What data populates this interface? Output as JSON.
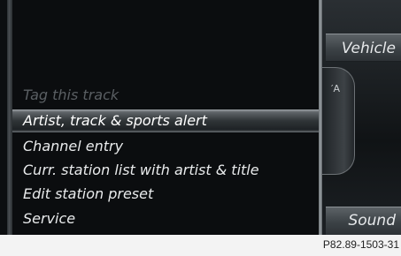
{
  "right_panel": {
    "vehicle_label": "Vehicle",
    "sound_label": "Sound",
    "knob_mark": "′A"
  },
  "menu": {
    "items": [
      {
        "label": "Tag this track",
        "state": "disabled"
      },
      {
        "label": "Artist, track & sports alert",
        "state": "selected"
      },
      {
        "label": "Channel entry",
        "state": "normal"
      },
      {
        "label": "Curr. station list with artist & title",
        "state": "normal"
      },
      {
        "label": "Edit station preset",
        "state": "normal"
      },
      {
        "label": "Service",
        "state": "normal"
      }
    ]
  },
  "footer": {
    "code": "P82.89-1503-31"
  }
}
